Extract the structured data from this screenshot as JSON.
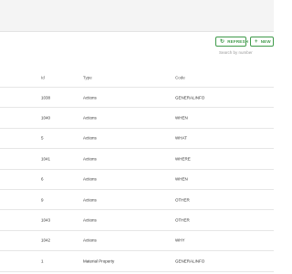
{
  "toolbar": {
    "refresh_label": "REFRESH",
    "new_label": "NEW",
    "refresh_icon": "refresh-icon",
    "new_icon": "plus-icon",
    "accent_color": "#3f9a4a"
  },
  "search": {
    "placeholder": "Search by number"
  },
  "table": {
    "columns": [
      "Id",
      "Type",
      "Code"
    ],
    "rows": [
      {
        "id": "1038",
        "type": "Actions",
        "code": "GENERALINFO"
      },
      {
        "id": "1040",
        "type": "Actions",
        "code": "WHEN"
      },
      {
        "id": "5",
        "type": "Actions",
        "code": "WHAT"
      },
      {
        "id": "1041",
        "type": "Actions",
        "code": "WHERE"
      },
      {
        "id": "6",
        "type": "Actions",
        "code": "WHEN"
      },
      {
        "id": "9",
        "type": "Actions",
        "code": "OTHER"
      },
      {
        "id": "1043",
        "type": "Actions",
        "code": "OTHER"
      },
      {
        "id": "1042",
        "type": "Actions",
        "code": "WHY"
      },
      {
        "id": "1",
        "type": "Material Property",
        "code": "GENERALINFO"
      }
    ]
  }
}
